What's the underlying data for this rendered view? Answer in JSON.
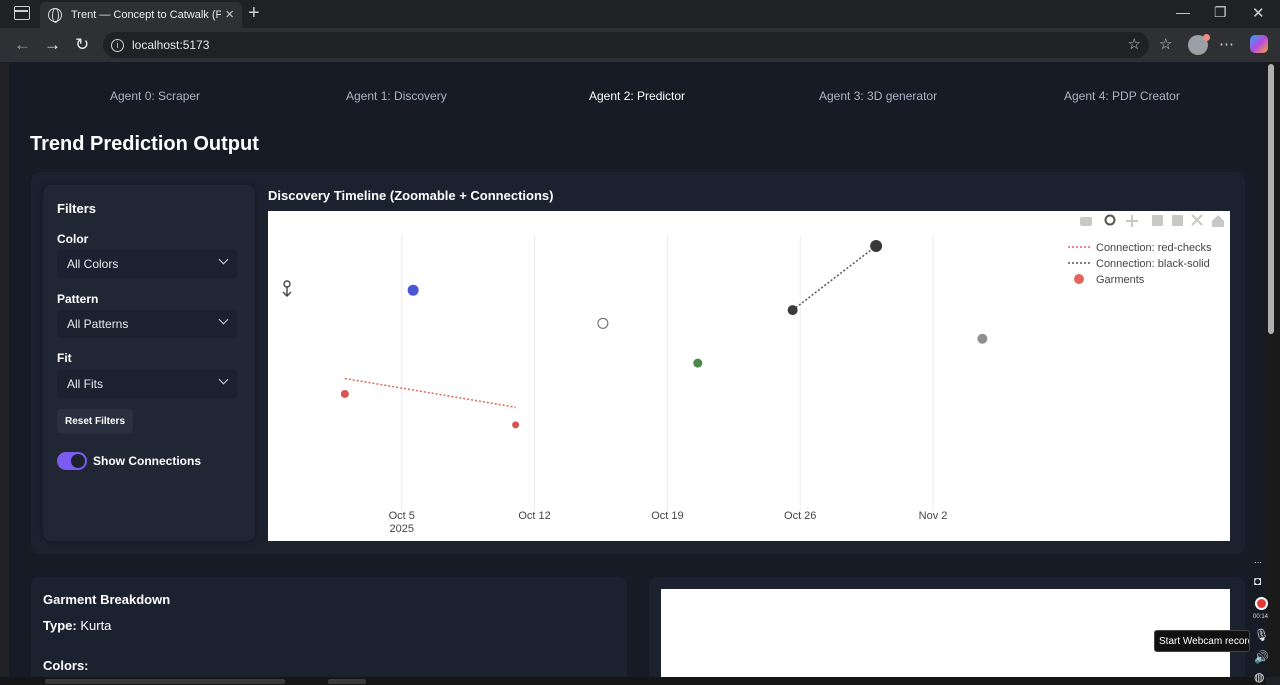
{
  "browser": {
    "tab_title": "Trent — Concept to Catwalk (PoC)",
    "url": "localhost:5173"
  },
  "nav": {
    "agents": [
      {
        "label": "Agent 0: Scraper",
        "active": false
      },
      {
        "label": "Agent 1: Discovery",
        "active": false
      },
      {
        "label": "Agent 2: Predictor",
        "active": true
      },
      {
        "label": "Agent 3: 3D generator",
        "active": false
      },
      {
        "label": "Agent 4: PDP Creator",
        "active": false
      }
    ]
  },
  "page": {
    "title": "Trend Prediction Output"
  },
  "filters": {
    "heading": "Filters",
    "color_label": "Color",
    "color_value": "All Colors",
    "pattern_label": "Pattern",
    "pattern_value": "All Patterns",
    "fit_label": "Fit",
    "fit_value": "All Fits",
    "reset_label": "Reset Filters",
    "show_connections_label": "Show Connections",
    "show_connections_on": true
  },
  "chart": {
    "title": "Discovery Timeline (Zoomable + Connections)"
  },
  "chart_data": {
    "type": "scatter",
    "title": "Discovery Timeline (Zoomable + Connections)",
    "x_ticks": [
      "Oct 5",
      "Oct 12",
      "Oct 19",
      "Oct 26",
      "Nov 2"
    ],
    "x_tick_values": [
      5,
      12,
      19,
      26,
      33
    ],
    "x_year_label": "2025",
    "xlim": [
      -2.05,
      48.65
    ],
    "ylim": [
      0,
      12.5
    ],
    "grid": true,
    "legend_position": "top-right",
    "legend": [
      {
        "name": "Connection: red-checks",
        "kind": "line",
        "color": "#e0655a"
      },
      {
        "name": "Connection: black-solid",
        "kind": "line",
        "color": "#555555"
      },
      {
        "name": "Garments",
        "kind": "marker",
        "color": "#e0655a"
      }
    ],
    "series": [
      {
        "name": "Garments",
        "points": [
          {
            "x": 2.0,
            "y": 5.3,
            "color": "#d9534f",
            "size": 4
          },
          {
            "x": 11.0,
            "y": 3.9,
            "color": "#d9534f",
            "size": 3.5
          },
          {
            "x": 5.6,
            "y": 10.0,
            "color": "#4a55d8",
            "size": 5.5
          },
          {
            "x": 15.6,
            "y": 8.5,
            "color": "#ffffff",
            "stroke": "#666666",
            "size": 5
          },
          {
            "x": 20.6,
            "y": 6.7,
            "color": "#4a8a4a",
            "size": 4.5
          },
          {
            "x": 25.6,
            "y": 9.1,
            "color": "#3a3a3a",
            "size": 5
          },
          {
            "x": 30.0,
            "y": 12.0,
            "color": "#3a3a3a",
            "size": 6
          },
          {
            "x": 35.6,
            "y": 7.8,
            "color": "#8f8f8f",
            "size": 5
          }
        ]
      },
      {
        "name": "Connection: red-checks",
        "line": [
          {
            "x": 2.0,
            "y": 6.0
          },
          {
            "x": 11.0,
            "y": 4.7
          }
        ],
        "color": "#e0655a"
      },
      {
        "name": "Connection: black-solid",
        "line": [
          {
            "x": 25.6,
            "y": 9.1
          },
          {
            "x": 30.0,
            "y": 12.0
          }
        ],
        "color": "#555555"
      }
    ]
  },
  "breakdown": {
    "title": "Garment Breakdown",
    "type_label": "Type:",
    "type_value": "Kurta",
    "colors_label": "Colors:"
  },
  "recorder": {
    "timer": "00:14",
    "tooltip": "Start Webcam recording"
  }
}
